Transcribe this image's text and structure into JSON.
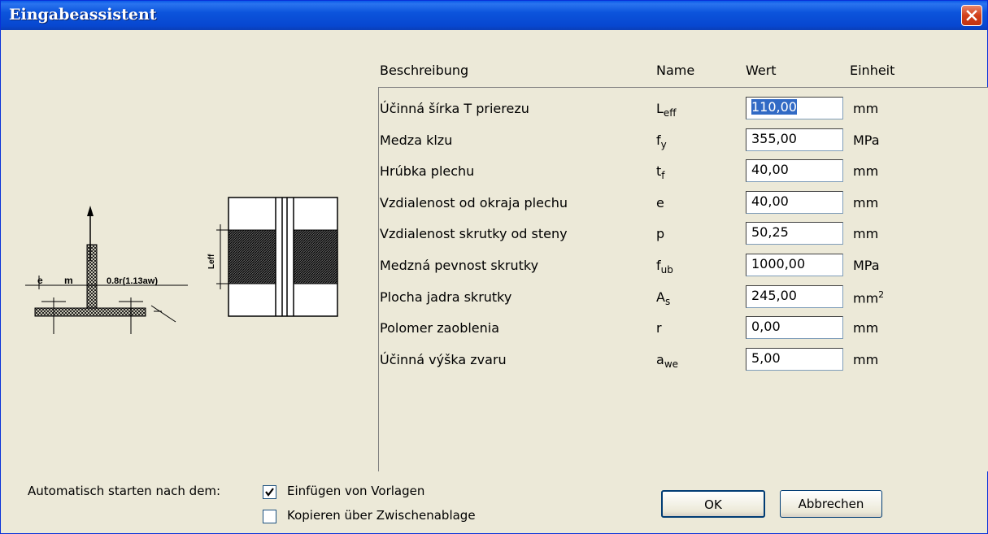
{
  "window": {
    "title": "Eingabeassistent"
  },
  "diagram": {
    "label_e": "e",
    "label_m": "m",
    "label_r": "0.8r(1.13aw)",
    "label_leff": "Leff"
  },
  "table": {
    "headers": {
      "description": "Beschreibung",
      "name": "Name",
      "value": "Wert",
      "unit": "Einheit"
    },
    "rows": [
      {
        "description": "Účinná šírka T prierezu",
        "name_base": "L",
        "name_sub": "eff",
        "value": "110,00",
        "unit": "mm",
        "unit_sup": ""
      },
      {
        "description": "Medza klzu",
        "name_base": "f",
        "name_sub": "y",
        "value": "355,00",
        "unit": "MPa",
        "unit_sup": ""
      },
      {
        "description": "Hrúbka plechu",
        "name_base": "t",
        "name_sub": "f",
        "value": "40,00",
        "unit": "mm",
        "unit_sup": ""
      },
      {
        "description": "Vzdialenost od okraja plechu",
        "name_base": "e",
        "name_sub": "",
        "value": "40,00",
        "unit": "mm",
        "unit_sup": ""
      },
      {
        "description": "Vzdialenost skrutky od steny",
        "name_base": "p",
        "name_sub": "",
        "value": "50,25",
        "unit": "mm",
        "unit_sup": ""
      },
      {
        "description": "Medzná pevnost skrutky",
        "name_base": "f",
        "name_sub": "ub",
        "value": "1000,00",
        "unit": "MPa",
        "unit_sup": ""
      },
      {
        "description": "Plocha jadra skrutky",
        "name_base": "A",
        "name_sub": "s",
        "value": "245,00",
        "unit": "mm",
        "unit_sup": "2"
      },
      {
        "description": "Polomer zaoblenia",
        "name_base": "r",
        "name_sub": "",
        "value": "0,00",
        "unit": "mm",
        "unit_sup": ""
      },
      {
        "description": "Účinná výška zvaru",
        "name_base": "a",
        "name_sub": "we",
        "value": "5,00",
        "unit": "mm",
        "unit_sup": ""
      }
    ]
  },
  "auto_start": {
    "label": "Automatisch starten nach dem:",
    "options": [
      {
        "label": "Einfügen von Vorlagen",
        "checked": true
      },
      {
        "label": "Kopieren über Zwischenablage",
        "checked": false
      }
    ]
  },
  "buttons": {
    "ok": "OK",
    "cancel": "Abbrechen"
  }
}
